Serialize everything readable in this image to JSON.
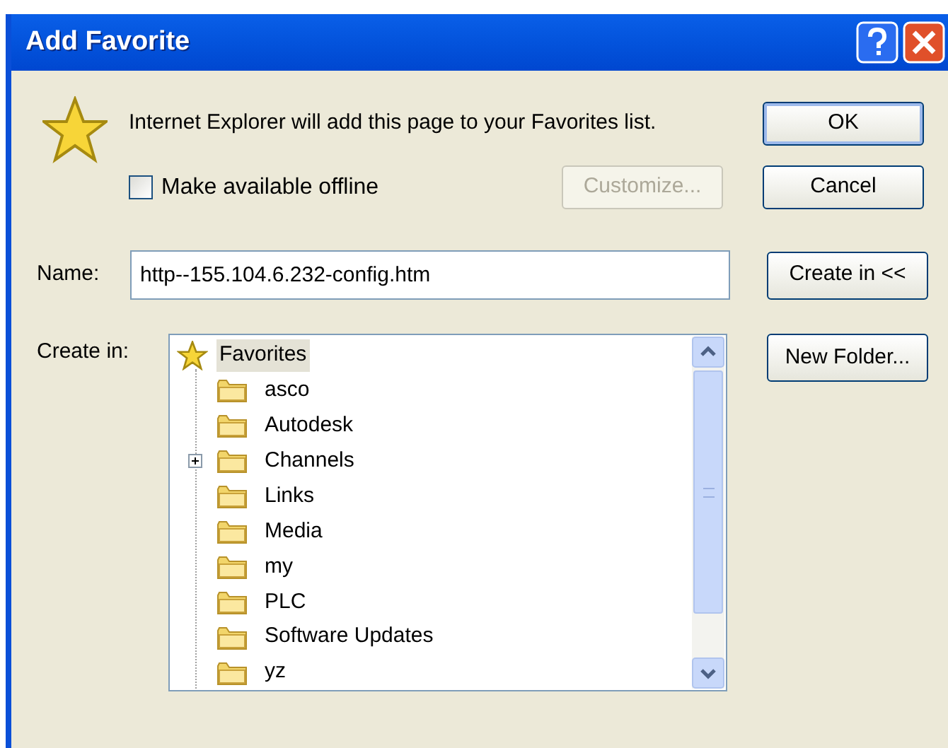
{
  "window": {
    "title": "Add Favorite"
  },
  "message": "Internet Explorer will add this page to your Favorites list.",
  "offline": {
    "label": "Make available offline",
    "checked": false
  },
  "customize_button": {
    "label": "Customize...",
    "disabled": true
  },
  "buttons": [
    {
      "label": "OK",
      "default": true
    },
    {
      "label": "Cancel",
      "default": false
    }
  ],
  "name_field": {
    "label": "Name:",
    "value": "http--155.104.6.232-config.htm"
  },
  "create_in_button": {
    "label": "Create in <<"
  },
  "new_folder_button": {
    "label": "New Folder..."
  },
  "tree": {
    "label": "Create in:",
    "root": {
      "label": "Favorites",
      "selected": true,
      "children": [
        {
          "label": "asco",
          "selected": false,
          "expandable": false
        },
        {
          "label": "Autodesk",
          "selected": false,
          "expandable": false
        },
        {
          "label": "Channels",
          "selected": false,
          "expandable": true
        },
        {
          "label": "Links",
          "selected": false,
          "expandable": false
        },
        {
          "label": "Media",
          "selected": false,
          "expandable": false
        },
        {
          "label": "my",
          "selected": false,
          "expandable": false
        },
        {
          "label": "PLC",
          "selected": false,
          "expandable": false
        },
        {
          "label": "Software Updates",
          "selected": false,
          "expandable": false
        },
        {
          "label": "yz",
          "selected": false,
          "expandable": false
        }
      ]
    }
  }
}
